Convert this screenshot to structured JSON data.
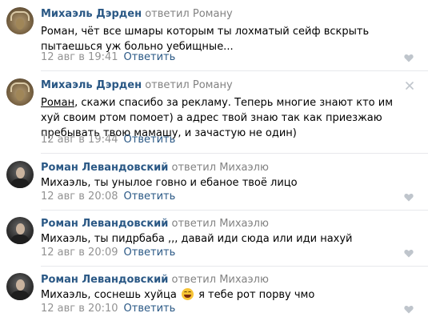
{
  "comments": [
    {
      "author": "Михаэль Дэрден",
      "action": "ответил",
      "reply_target": "Роману",
      "text": "Роман, чёт все шмары которым ты лохматый сейф вскрыть пытаешься уж больно уебищные...",
      "date": "12 авг в 19:41",
      "reply_label": "Ответить",
      "avatar": "deer-avatar",
      "icon": "heart-icon"
    },
    {
      "author": "Михаэль Дэрден",
      "action": "ответил",
      "reply_target": "Роману",
      "mention": "Роман",
      "text": ", скажи спасибо за рекламу. Теперь многие знают кто им хуй своим ртом помоет) а адрес твой знаю так как приезжаю пребывать твою мамашу, и зачастую не один)",
      "date": "12 авг в 19:44",
      "reply_label": "Ответить",
      "avatar": "deer-avatar",
      "icon": "close-icon"
    },
    {
      "author": "Роман Левандовский",
      "action": "ответил",
      "reply_target": "Михаэлю",
      "text": "Михаэль, ты унылое говно и ебаное твоё лицо",
      "date": "12 авг в 20:08",
      "reply_label": "Ответить",
      "avatar": "person-avatar",
      "icon": "heart-icon"
    },
    {
      "author": "Роман Левандовский",
      "action": "ответил",
      "reply_target": "Михаэлю",
      "text": "Михаэль, ты пидрбаба ,,, давай иди сюда или иди нахуй",
      "date": "12 авг в 20:09",
      "reply_label": "Ответить",
      "avatar": "person-avatar",
      "icon": "heart-icon"
    },
    {
      "author": "Роман Левандовский",
      "action": "ответил",
      "reply_target": "Михаэлю",
      "text_before_emoji": "Михаэль, соснешь хуйца",
      "emoji": "grinning-emoji",
      "text_after_emoji": "я тебе рот порву чмо",
      "date": "12 авг в 20:10",
      "reply_label": "Ответить",
      "avatar": "person-avatar",
      "icon": "heart-icon"
    }
  ],
  "colors": {
    "link": "#2a5885",
    "muted": "#828282",
    "date": "#939393",
    "divider": "#e7e8ec",
    "icon": "#bfc5cc"
  }
}
